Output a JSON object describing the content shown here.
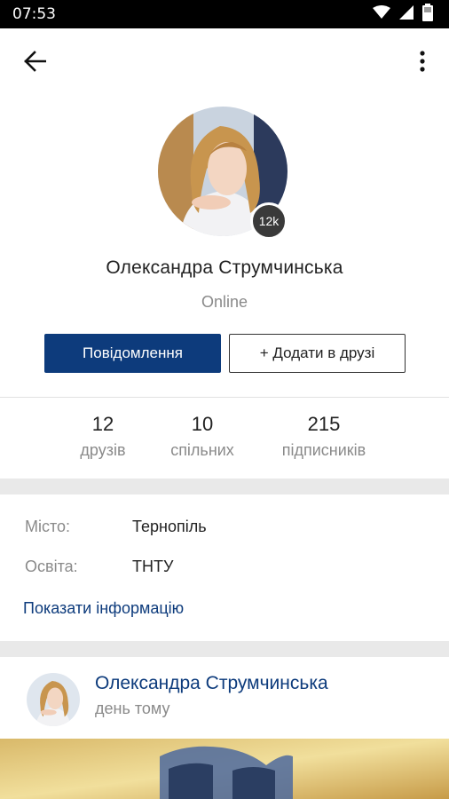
{
  "statusbar": {
    "time": "07:53"
  },
  "icons": {
    "back": "arrow-left-icon",
    "more": "more-vertical-icon",
    "wifi": "wifi-icon",
    "signal": "signal-icon",
    "battery": "battery-icon"
  },
  "colors": {
    "brand": "#0d3b7c",
    "muted": "#8a8a8a",
    "text": "#222222",
    "separator": "#e9e9e9"
  },
  "profile": {
    "name": "Олександра Струмчинська",
    "status": "Online",
    "badge": "12k",
    "message_button": "Повідомлення",
    "add_friend_button": "+ Додати в друзі"
  },
  "stats": [
    {
      "value": "12",
      "label": "друзів"
    },
    {
      "value": "10",
      "label": "спільних"
    },
    {
      "value": "215",
      "label": "підписників"
    }
  ],
  "info": {
    "rows": [
      {
        "label": "Місто:",
        "value": "Тернопіль"
      },
      {
        "label": "Освіта:",
        "value": "ТНТУ"
      }
    ],
    "show_more_link": "Показати інформацію"
  },
  "post": {
    "author": "Олександра Струмчинська",
    "time": "день тому"
  }
}
